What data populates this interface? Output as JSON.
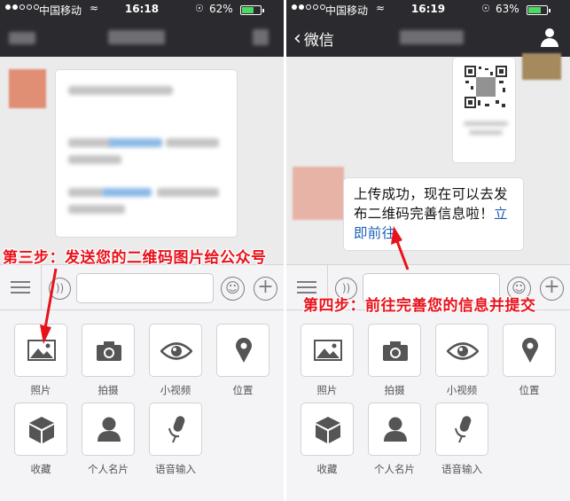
{
  "colors": {
    "bar": "#2b2b2f",
    "chat_bg": "#ebebeb",
    "panel_bg": "#f4f4f6",
    "link": "#1b5fb5",
    "annotation": "#e8121b",
    "battery": "#4cd964"
  },
  "left": {
    "status": {
      "carrier": "中国移动",
      "time": "16:18",
      "battery_text": "62%",
      "battery_level": 0.62
    },
    "annotation": "第三步：发送您的二维码图片给公众号"
  },
  "right": {
    "status": {
      "carrier": "中国移动",
      "time": "16:19",
      "battery_text": "63%",
      "battery_level": 0.63
    },
    "nav": {
      "back_label": "微信"
    },
    "message": {
      "text": "上传成功，现在可以去发布二维码完善信息啦！",
      "link": "立即前往"
    },
    "annotation": "第四步：前往完善您的信息并提交"
  },
  "panel_items": [
    {
      "label": "照片",
      "icon": "photo-icon"
    },
    {
      "label": "拍摄",
      "icon": "camera-icon"
    },
    {
      "label": "小视频",
      "icon": "eye-icon"
    },
    {
      "label": "位置",
      "icon": "location-pin-icon"
    },
    {
      "label": "收藏",
      "icon": "favorites-cube-icon"
    },
    {
      "label": "个人名片",
      "icon": "contact-card-icon"
    },
    {
      "label": "语音输入",
      "icon": "microphone-icon"
    }
  ]
}
